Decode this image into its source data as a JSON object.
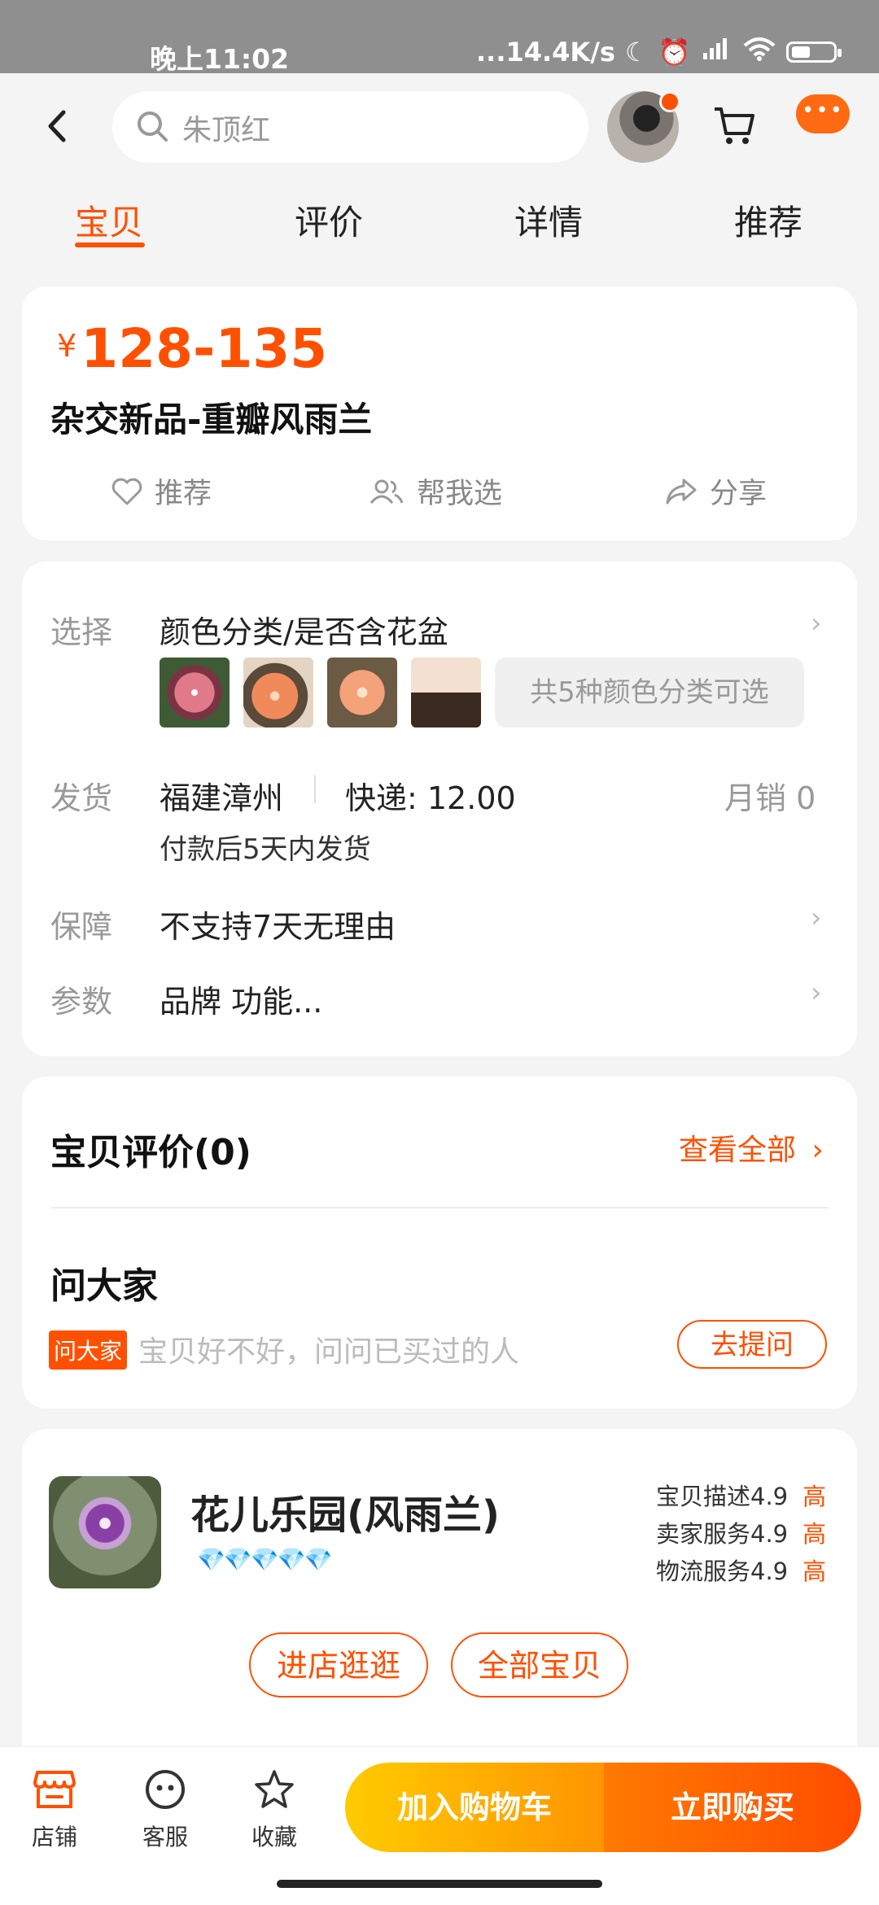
{
  "status_bar": {
    "time": "晚上11:02",
    "network": "...14.4K/s"
  },
  "search": {
    "placeholder": "朱顶红"
  },
  "tabs": [
    {
      "label": "宝贝",
      "active": true
    },
    {
      "label": "评价"
    },
    {
      "label": "详情"
    },
    {
      "label": "推荐"
    }
  ],
  "product": {
    "currency": "¥",
    "price": "128-135",
    "title": "杂交新品-重瓣风雨兰",
    "actions": {
      "recommend": "推荐",
      "help_choose": "帮我选",
      "share": "分享"
    }
  },
  "specs": {
    "select": {
      "label": "选择",
      "value": "颜色分类/是否含花盆",
      "more": "共5种颜色分类可选"
    },
    "shipping": {
      "label": "发货",
      "origin": "福建漳州",
      "fee": "快递: 12.00",
      "monthly_sales": "月销 0",
      "note": "付款后5天内发货"
    },
    "guarantee": {
      "label": "保障",
      "value": "不支持7天无理由"
    },
    "params": {
      "label": "参数",
      "value": "品牌 功能..."
    }
  },
  "reviews": {
    "title": "宝贝评价(0)",
    "view_all": "查看全部"
  },
  "ask": {
    "title": "问大家",
    "tag": "问大家",
    "placeholder": "宝贝好不好，问问已买过的人",
    "button": "去提问"
  },
  "shop": {
    "name": "花儿乐园(风雨兰)",
    "rating_gems": 5,
    "scores": [
      {
        "label": "宝贝描述4.9",
        "level": "高"
      },
      {
        "label": "卖家服务4.9",
        "level": "高"
      },
      {
        "label": "物流服务4.9",
        "level": "高"
      }
    ],
    "visit_button": "进店逛逛",
    "all_items_button": "全部宝贝"
  },
  "bottom_bar": {
    "shop": "店铺",
    "service": "客服",
    "favorite": "收藏",
    "add_to_cart": "加入购物车",
    "buy_now": "立即购买"
  },
  "colors": {
    "accent": "#ff5000",
    "cart_gradient_start": "#ffcb00",
    "buy_gradient_end": "#ff4c00"
  }
}
